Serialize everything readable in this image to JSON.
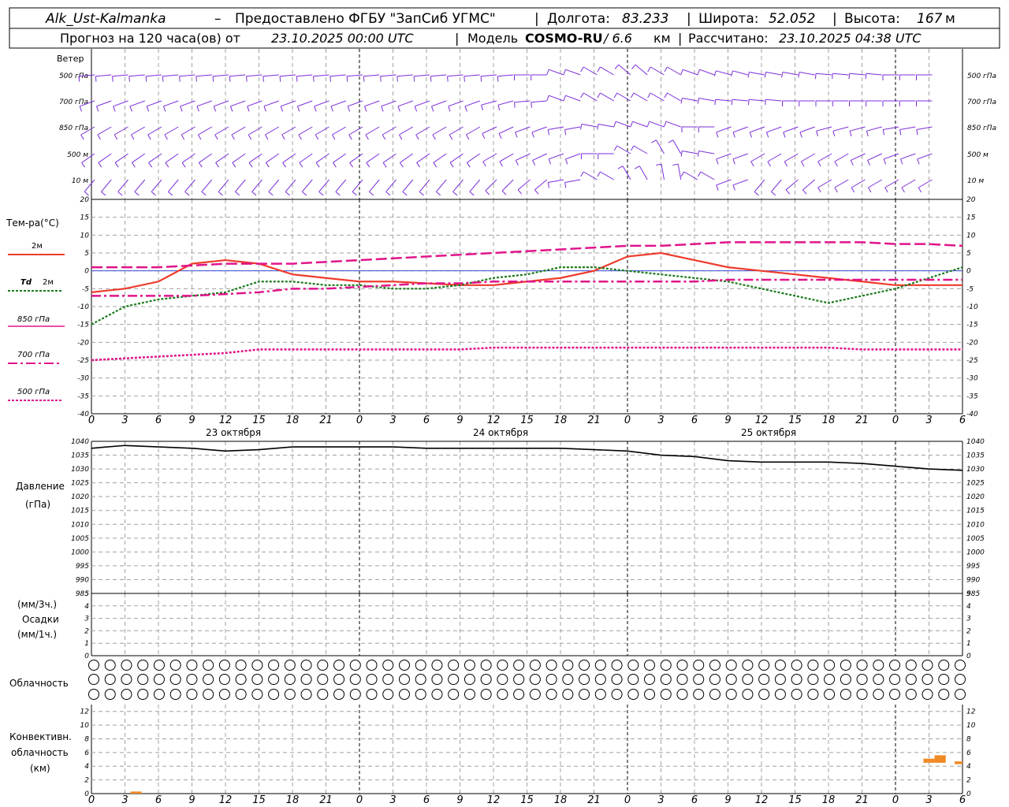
{
  "header": {
    "station": "Alk_Ust-Kalmanka",
    "dash": "–",
    "provider": "Предоставлено ФГБУ \"ЗапСиб УГМС\"",
    "lon_label": "Долгота:",
    "lon_value": "83.233",
    "lat_label": "Широта:",
    "lat_value": "52.052",
    "alt_label": "Высота:",
    "alt_value": "167",
    "alt_unit": "м",
    "forecast_label": "Прогноз на 120 часа(ов) от",
    "forecast_from": "23.10.2025 00:00 UTC",
    "model_label": "Модель",
    "model_name": "COSMO-RU",
    "model_res": "/ 6.6",
    "model_res_unit": "км",
    "calc_label": "Рассчитано:",
    "calc_value": "23.10.2025 04:38 UTC",
    "sep": "|"
  },
  "colors": {
    "wind": "#7b2ddb",
    "t2m": "#ee3b2c",
    "td2m": "#1b7a1b",
    "t850": "#e0148a",
    "t700": "#e0148a",
    "t500": "#e0148a",
    "pressure": "#000000",
    "cloud_fill": "#000000",
    "convective": "#f08a24",
    "zero_line": "#3a4bd8",
    "grid": "#a0a0a0"
  },
  "chart_data": [
    {
      "type": "wind_barbs",
      "title": "Ветер",
      "levels": [
        "500 гПа",
        "700 гПа",
        "850 гПа",
        "500 м",
        "10   м"
      ],
      "hours": [
        0,
        3,
        6,
        9,
        12,
        15,
        18,
        21,
        24,
        27,
        30,
        33,
        36,
        39,
        42,
        45,
        48,
        51,
        54,
        57,
        60,
        63,
        66,
        69,
        72,
        75,
        78
      ],
      "dir_deg": {
        "500 гПа": [
          265,
          265,
          265,
          265,
          265,
          265,
          265,
          265,
          265,
          265,
          265,
          265,
          265,
          270,
          290,
          300,
          310,
          300,
          290,
          285,
          280,
          280,
          275,
          275,
          270,
          270,
          270
        ],
        "700 гПа": [
          250,
          250,
          250,
          250,
          250,
          250,
          250,
          250,
          250,
          250,
          250,
          250,
          255,
          265,
          290,
          300,
          300,
          300,
          280,
          275,
          275,
          270,
          270,
          270,
          270,
          270,
          270
        ],
        "850 гПа": [
          240,
          240,
          240,
          240,
          240,
          240,
          240,
          240,
          240,
          240,
          240,
          240,
          245,
          250,
          260,
          280,
          290,
          290,
          270,
          250,
          250,
          250,
          255,
          255,
          260,
          260,
          260
        ],
        "500 м": [
          235,
          235,
          235,
          235,
          235,
          235,
          235,
          235,
          235,
          235,
          235,
          235,
          240,
          245,
          250,
          270,
          300,
          330,
          280,
          250,
          240,
          240,
          240,
          245,
          250,
          250,
          250
        ],
        "10   м": [
          220,
          220,
          220,
          220,
          220,
          220,
          220,
          220,
          220,
          220,
          220,
          220,
          225,
          230,
          260,
          300,
          330,
          350,
          300,
          250,
          220,
          230,
          240,
          240,
          240,
          240,
          240
        ]
      }
    },
    {
      "type": "line",
      "ylabel": "Тем-ра(°С)",
      "ylim": [
        -40,
        20
      ],
      "yticks": [
        20,
        15,
        10,
        5,
        0,
        -5,
        -10,
        -15,
        -20,
        -25,
        -30,
        -35,
        -40
      ],
      "x_hours": [
        0,
        3,
        6,
        9,
        12,
        15,
        18,
        21,
        24,
        27,
        30,
        33,
        36,
        39,
        42,
        45,
        48,
        51,
        54,
        57,
        60,
        63,
        66,
        69,
        72,
        75,
        78
      ],
      "series": [
        {
          "name": "2м",
          "values": [
            -6,
            -5,
            -3,
            2,
            3,
            2,
            -1,
            -2,
            -3,
            -3,
            -3.5,
            -4,
            -4,
            -3,
            -2,
            0,
            4,
            5,
            3,
            1,
            0,
            -1,
            -2,
            -3,
            -4,
            -4,
            -4
          ]
        },
        {
          "name": "Td 2м",
          "values": [
            -15,
            -10,
            -8,
            -7,
            -6,
            -3,
            -3,
            -4,
            -4,
            -5,
            -5,
            -4,
            -2,
            -1,
            1,
            1,
            0,
            -1,
            -2,
            -3,
            -5,
            -7,
            -9,
            -7,
            -5,
            -2,
            1
          ]
        },
        {
          "name": "850 гПа",
          "values": [
            1,
            1,
            1,
            1.5,
            2,
            2,
            2,
            2.5,
            3,
            3.5,
            4,
            4.5,
            5,
            5.5,
            6,
            6.5,
            7,
            7,
            7.5,
            8,
            8,
            8,
            8,
            8,
            7.5,
            7.5,
            7
          ]
        },
        {
          "name": "700 гПа",
          "values": [
            -7,
            -7,
            -7,
            -7,
            -6.5,
            -6,
            -5,
            -5,
            -4.5,
            -4,
            -3.5,
            -3.5,
            -3,
            -3,
            -3,
            -3,
            -3,
            -3,
            -3,
            -2.5,
            -2.5,
            -2.5,
            -2.5,
            -2.5,
            -2.5,
            -2.5,
            -2.5
          ]
        },
        {
          "name": "500 гПа",
          "values": [
            -25,
            -24.5,
            -24,
            -23.5,
            -23,
            -22,
            -22,
            -22,
            -22,
            -22,
            -22,
            -22,
            -21.5,
            -21.5,
            -21.5,
            -21.5,
            -21.5,
            -21.5,
            -21.5,
            -21.5,
            -21.5,
            -21.5,
            -21.5,
            -22,
            -22,
            -22,
            -22
          ]
        }
      ]
    },
    {
      "type": "line",
      "ylabel": "Давление",
      "yunit": "(гПа)",
      "ylim": [
        985,
        1040
      ],
      "yticks": [
        1040,
        1035,
        1030,
        1025,
        1020,
        1015,
        1010,
        1005,
        1000,
        995,
        990,
        985
      ],
      "x_hours": [
        0,
        3,
        6,
        9,
        12,
        15,
        18,
        21,
        24,
        27,
        30,
        33,
        36,
        39,
        42,
        45,
        48,
        51,
        54,
        57,
        60,
        63,
        66,
        69,
        72,
        75,
        78
      ],
      "series": [
        {
          "name": "Давление",
          "values": [
            1037.5,
            1038.5,
            1038,
            1037.5,
            1036.5,
            1037,
            1038,
            1038,
            1038,
            1038,
            1037.5,
            1037.5,
            1037.5,
            1037.5,
            1037.5,
            1037,
            1036.5,
            1035,
            1034.5,
            1033,
            1032.5,
            1032.5,
            1032.5,
            1032,
            1031,
            1030,
            1029.5
          ]
        }
      ]
    },
    {
      "type": "bar",
      "ylabel_top": "(мм/3ч.)",
      "ylabel": "Осадки",
      "ylabel_bottom": "(мм/1ч.)",
      "ylim": [
        0,
        5
      ],
      "yticks": [
        5,
        4,
        3,
        2,
        1,
        0
      ],
      "values": []
    },
    {
      "type": "symbols",
      "ylabel": "Облачность",
      "rows": 3,
      "columns": 54,
      "row_cover": [
        [
          0,
          0,
          0,
          0,
          0,
          0,
          0,
          0,
          0,
          0,
          0,
          0,
          0,
          0,
          0,
          0,
          0,
          0,
          0,
          0,
          0,
          0,
          0,
          0,
          0,
          0,
          0,
          0,
          0,
          0,
          0,
          0,
          0,
          0,
          0,
          0,
          0,
          0,
          0,
          0,
          0,
          0,
          0,
          0,
          0,
          0,
          0,
          0,
          0,
          0,
          0,
          0,
          0,
          0
        ],
        [
          0,
          0,
          0,
          0,
          0,
          0,
          0,
          0,
          0,
          0,
          0,
          0,
          0,
          0,
          0,
          0,
          0,
          0,
          0,
          0,
          0,
          0,
          0,
          0,
          0,
          0,
          0,
          0,
          0,
          0,
          0,
          0,
          0,
          0,
          0,
          0,
          0,
          0,
          0,
          0,
          0,
          0,
          0,
          0,
          0,
          0,
          0,
          0,
          0,
          0,
          0,
          0,
          0,
          0
        ],
        [
          0,
          0,
          0,
          0,
          0,
          0,
          0,
          0,
          0,
          0,
          0,
          0,
          0,
          0,
          0,
          0,
          0,
          0,
          0,
          0,
          0,
          0,
          0,
          0,
          0,
          0,
          0,
          0,
          0,
          0,
          0,
          0,
          0,
          0,
          0,
          0,
          0,
          0,
          0,
          0,
          0,
          0,
          0,
          0,
          0,
          0,
          0,
          0,
          0,
          0,
          0,
          0,
          0,
          0
        ]
      ]
    },
    {
      "type": "bar",
      "ylabel": "Конвективн.",
      "ylabel2": "облачность",
      "yunit": "(км)",
      "ylim": [
        0,
        13
      ],
      "yticks": [
        12,
        10,
        8,
        6,
        4,
        2,
        0
      ],
      "bars": [
        {
          "x0": 3.5,
          "x1": 4.5,
          "y0": 0,
          "y1": 0.3
        },
        {
          "x0": 74.5,
          "x1": 75.5,
          "y0": 4.5,
          "y1": 5.1
        },
        {
          "x0": 75.5,
          "x1": 76.5,
          "y0": 4.5,
          "y1": 5.6
        },
        {
          "x0": 77.3,
          "x1": 78,
          "y0": 4.3,
          "y1": 4.7
        }
      ]
    }
  ],
  "x_axis": {
    "tick_labels": [
      "0",
      "3",
      "6",
      "9",
      "12",
      "15",
      "18",
      "21",
      "0",
      "3",
      "6",
      "9",
      "12",
      "15",
      "18",
      "21",
      "0",
      "3",
      "6",
      "9",
      "12",
      "15",
      "18",
      "21",
      "0",
      "3",
      "6"
    ],
    "day_labels": [
      "23 октября",
      "24 октября",
      "25 октября"
    ]
  },
  "legend": {
    "t2m": "2м",
    "td2m_a": "Td",
    "td2m_b": "2м",
    "t850": "850 гПа",
    "t700": "700 гПа",
    "t500": "500 гПа"
  }
}
